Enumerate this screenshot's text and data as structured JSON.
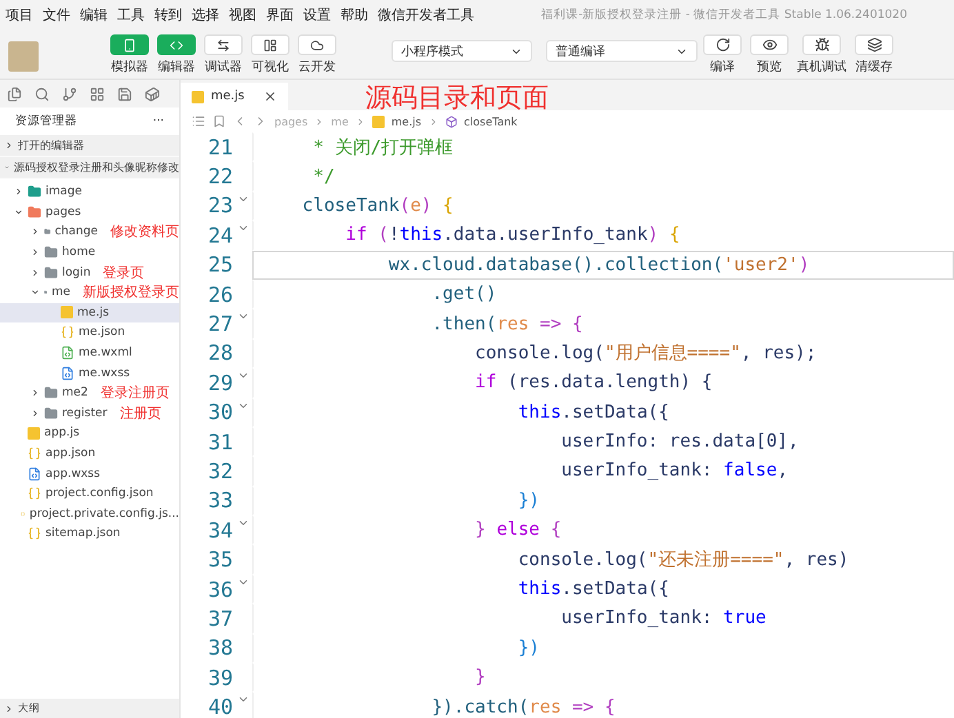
{
  "menu": [
    "项目",
    "文件",
    "编辑",
    "工具",
    "转到",
    "选择",
    "视图",
    "界面",
    "设置",
    "帮助",
    "微信开发者工具"
  ],
  "window": {
    "title": "福利课-新版授权登录注册 - 微信开发者工具 Stable 1.06.2401020"
  },
  "toolbar": {
    "views": [
      {
        "label": "模拟器",
        "kind": "phone",
        "selected": true
      },
      {
        "label": "编辑器",
        "kind": "code",
        "selected": true
      },
      {
        "label": "调试器",
        "kind": "debug",
        "selected": false
      },
      {
        "label": "可视化",
        "kind": "layout",
        "selected": false
      },
      {
        "label": "云开发",
        "kind": "cloud",
        "selected": false
      }
    ],
    "mode": "小程序模式",
    "compile_mode": "普通编译",
    "actions": [
      {
        "label": "编译",
        "kind": "refresh"
      },
      {
        "label": "预览",
        "kind": "eye"
      },
      {
        "label": "真机调试",
        "kind": "bug"
      },
      {
        "label": "清缓存",
        "kind": "layers"
      }
    ]
  },
  "sidebar": {
    "title": "资源管理器",
    "menu": "···",
    "sections": [
      {
        "label": "打开的编辑器",
        "expanded": false
      },
      {
        "label": "源码授权登录注册和头像昵称修改",
        "expanded": true
      }
    ],
    "tree": [
      {
        "label": "image",
        "kind": "folder-image",
        "expanded": false
      },
      {
        "label": "pages",
        "kind": "folder-pages",
        "expanded": true,
        "children": [
          {
            "label": "change",
            "kind": "folder",
            "expanded": false,
            "note": "修改资料页"
          },
          {
            "label": "home",
            "kind": "folder",
            "expanded": false
          },
          {
            "label": "login",
            "kind": "folder",
            "expanded": false,
            "note": "登录页"
          },
          {
            "label": "me",
            "kind": "folder",
            "expanded": true,
            "note": "新版授权登录页",
            "children": [
              {
                "label": "me.js",
                "kind": "js",
                "selected": true
              },
              {
                "label": "me.json",
                "kind": "json",
                "selected": false
              },
              {
                "label": "me.wxml",
                "kind": "wxml",
                "selected": false
              },
              {
                "label": "me.wxss",
                "kind": "wxss",
                "selected": false
              }
            ]
          },
          {
            "label": "me2",
            "kind": "folder",
            "expanded": false,
            "note": "登录注册页"
          },
          {
            "label": "register",
            "kind": "folder",
            "expanded": false,
            "note": "注册页"
          }
        ]
      },
      {
        "label": "app.js",
        "kind": "js",
        "selected": false
      },
      {
        "label": "app.json",
        "kind": "json",
        "selected": false
      },
      {
        "label": "app.wxss",
        "kind": "wxss",
        "selected": false
      },
      {
        "label": "project.config.json",
        "kind": "json",
        "selected": false
      },
      {
        "label": "project.private.config.js...",
        "kind": "json",
        "selected": false
      },
      {
        "label": "sitemap.json",
        "kind": "json",
        "selected": false
      }
    ],
    "outline": "大纲"
  },
  "editor": {
    "tab": "me.js",
    "annotation": "源码目录和页面",
    "breadcrumb": [
      "pages",
      "me",
      "me.js",
      "closeTank"
    ],
    "lines": [
      {
        "number": "21",
        "fold": false,
        "current": false,
        "tokens": [
          {
            "text": "     * 关闭/打开弹框",
            "kind": "comment"
          }
        ]
      },
      {
        "number": "22",
        "fold": false,
        "current": false,
        "tokens": [
          {
            "text": "     */",
            "kind": "comment"
          }
        ]
      },
      {
        "number": "23",
        "fold": true,
        "current": false,
        "tokens": [
          {
            "text": "    closeTank",
            "kind": "fn"
          },
          {
            "text": "(",
            "kind": "br2"
          },
          {
            "text": "e",
            "kind": "param"
          },
          {
            "text": ")",
            "kind": "br2"
          },
          {
            "text": " {",
            "kind": "br1"
          }
        ]
      },
      {
        "number": "24",
        "fold": true,
        "current": false,
        "tokens": [
          {
            "text": "        if",
            "kind": "kw"
          },
          {
            "text": " (",
            "kind": "br2"
          },
          {
            "text": "!",
            "kind": "plain"
          },
          {
            "text": "this",
            "kind": "const"
          },
          {
            "text": ".data.userInfo_tank",
            "kind": "plain"
          },
          {
            "text": ")",
            "kind": "br2"
          },
          {
            "text": " {",
            "kind": "br1"
          }
        ]
      },
      {
        "number": "25",
        "fold": false,
        "current": true,
        "tokens": [
          {
            "text": "            wx.cloud.database().collection(",
            "kind": "fn"
          },
          {
            "text": "'user2'",
            "kind": "str"
          },
          {
            "text": ")",
            "kind": "br2"
          }
        ]
      },
      {
        "number": "26",
        "fold": false,
        "current": false,
        "tokens": [
          {
            "text": "                .get()",
            "kind": "fn"
          }
        ]
      },
      {
        "number": "27",
        "fold": true,
        "current": false,
        "tokens": [
          {
            "text": "                .then(",
            "kind": "fn"
          },
          {
            "text": "res",
            "kind": "param"
          },
          {
            "text": " => {",
            "kind": "br2"
          }
        ]
      },
      {
        "number": "28",
        "fold": false,
        "current": false,
        "tokens": [
          {
            "text": "                    console.log(",
            "kind": "plain"
          },
          {
            "text": "\"用户信息====\"",
            "kind": "str"
          },
          {
            "text": ", res);",
            "kind": "plain"
          }
        ]
      },
      {
        "number": "29",
        "fold": true,
        "current": false,
        "tokens": [
          {
            "text": "                    if",
            "kind": "kw"
          },
          {
            "text": " (res.data.length) {",
            "kind": "plain"
          }
        ]
      },
      {
        "number": "30",
        "fold": true,
        "current": false,
        "tokens": [
          {
            "text": "                        this",
            "kind": "const"
          },
          {
            "text": ".setData({",
            "kind": "plain"
          }
        ]
      },
      {
        "number": "31",
        "fold": false,
        "current": false,
        "tokens": [
          {
            "text": "                            userInfo: res.data[0],",
            "kind": "plain"
          }
        ]
      },
      {
        "number": "32",
        "fold": false,
        "current": false,
        "tokens": [
          {
            "text": "                            userInfo_tank: ",
            "kind": "plain"
          },
          {
            "text": "false",
            "kind": "const"
          },
          {
            "text": ",",
            "kind": "plain"
          }
        ]
      },
      {
        "number": "33",
        "fold": false,
        "current": false,
        "tokens": [
          {
            "text": "                        })",
            "kind": "br3"
          }
        ]
      },
      {
        "number": "34",
        "fold": true,
        "current": false,
        "tokens": [
          {
            "text": "                    } ",
            "kind": "br2"
          },
          {
            "text": "else",
            "kind": "kw"
          },
          {
            "text": " {",
            "kind": "br2"
          }
        ]
      },
      {
        "number": "35",
        "fold": false,
        "current": false,
        "tokens": [
          {
            "text": "                        console.log(",
            "kind": "plain"
          },
          {
            "text": "\"还未注册====\"",
            "kind": "str"
          },
          {
            "text": ", res)",
            "kind": "plain"
          }
        ]
      },
      {
        "number": "36",
        "fold": true,
        "current": false,
        "tokens": [
          {
            "text": "                        this",
            "kind": "const"
          },
          {
            "text": ".setData({",
            "kind": "plain"
          }
        ]
      },
      {
        "number": "37",
        "fold": false,
        "current": false,
        "tokens": [
          {
            "text": "                            userInfo_tank: ",
            "kind": "plain"
          },
          {
            "text": "true",
            "kind": "const"
          }
        ]
      },
      {
        "number": "38",
        "fold": false,
        "current": false,
        "tokens": [
          {
            "text": "                        })",
            "kind": "br3"
          }
        ]
      },
      {
        "number": "39",
        "fold": false,
        "current": false,
        "tokens": [
          {
            "text": "                    }",
            "kind": "br2"
          }
        ]
      },
      {
        "number": "40",
        "fold": true,
        "current": false,
        "tokens": [
          {
            "text": "                }).catch(",
            "kind": "fn"
          },
          {
            "text": "res",
            "kind": "param"
          },
          {
            "text": " => {",
            "kind": "br2"
          }
        ]
      }
    ]
  }
}
